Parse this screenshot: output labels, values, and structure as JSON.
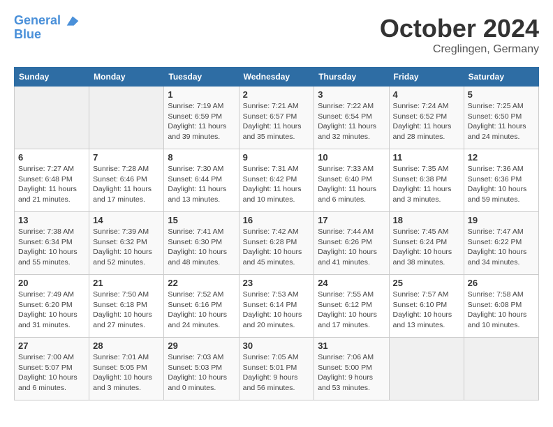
{
  "header": {
    "logo_line1": "General",
    "logo_line2": "Blue",
    "month": "October 2024",
    "location": "Creglingen, Germany"
  },
  "weekdays": [
    "Sunday",
    "Monday",
    "Tuesday",
    "Wednesday",
    "Thursday",
    "Friday",
    "Saturday"
  ],
  "weeks": [
    [
      {
        "num": "",
        "info": ""
      },
      {
        "num": "",
        "info": ""
      },
      {
        "num": "1",
        "info": "Sunrise: 7:19 AM\nSunset: 6:59 PM\nDaylight: 11 hours and 39 minutes."
      },
      {
        "num": "2",
        "info": "Sunrise: 7:21 AM\nSunset: 6:57 PM\nDaylight: 11 hours and 35 minutes."
      },
      {
        "num": "3",
        "info": "Sunrise: 7:22 AM\nSunset: 6:54 PM\nDaylight: 11 hours and 32 minutes."
      },
      {
        "num": "4",
        "info": "Sunrise: 7:24 AM\nSunset: 6:52 PM\nDaylight: 11 hours and 28 minutes."
      },
      {
        "num": "5",
        "info": "Sunrise: 7:25 AM\nSunset: 6:50 PM\nDaylight: 11 hours and 24 minutes."
      }
    ],
    [
      {
        "num": "6",
        "info": "Sunrise: 7:27 AM\nSunset: 6:48 PM\nDaylight: 11 hours and 21 minutes."
      },
      {
        "num": "7",
        "info": "Sunrise: 7:28 AM\nSunset: 6:46 PM\nDaylight: 11 hours and 17 minutes."
      },
      {
        "num": "8",
        "info": "Sunrise: 7:30 AM\nSunset: 6:44 PM\nDaylight: 11 hours and 13 minutes."
      },
      {
        "num": "9",
        "info": "Sunrise: 7:31 AM\nSunset: 6:42 PM\nDaylight: 11 hours and 10 minutes."
      },
      {
        "num": "10",
        "info": "Sunrise: 7:33 AM\nSunset: 6:40 PM\nDaylight: 11 hours and 6 minutes."
      },
      {
        "num": "11",
        "info": "Sunrise: 7:35 AM\nSunset: 6:38 PM\nDaylight: 11 hours and 3 minutes."
      },
      {
        "num": "12",
        "info": "Sunrise: 7:36 AM\nSunset: 6:36 PM\nDaylight: 10 hours and 59 minutes."
      }
    ],
    [
      {
        "num": "13",
        "info": "Sunrise: 7:38 AM\nSunset: 6:34 PM\nDaylight: 10 hours and 55 minutes."
      },
      {
        "num": "14",
        "info": "Sunrise: 7:39 AM\nSunset: 6:32 PM\nDaylight: 10 hours and 52 minutes."
      },
      {
        "num": "15",
        "info": "Sunrise: 7:41 AM\nSunset: 6:30 PM\nDaylight: 10 hours and 48 minutes."
      },
      {
        "num": "16",
        "info": "Sunrise: 7:42 AM\nSunset: 6:28 PM\nDaylight: 10 hours and 45 minutes."
      },
      {
        "num": "17",
        "info": "Sunrise: 7:44 AM\nSunset: 6:26 PM\nDaylight: 10 hours and 41 minutes."
      },
      {
        "num": "18",
        "info": "Sunrise: 7:45 AM\nSunset: 6:24 PM\nDaylight: 10 hours and 38 minutes."
      },
      {
        "num": "19",
        "info": "Sunrise: 7:47 AM\nSunset: 6:22 PM\nDaylight: 10 hours and 34 minutes."
      }
    ],
    [
      {
        "num": "20",
        "info": "Sunrise: 7:49 AM\nSunset: 6:20 PM\nDaylight: 10 hours and 31 minutes."
      },
      {
        "num": "21",
        "info": "Sunrise: 7:50 AM\nSunset: 6:18 PM\nDaylight: 10 hours and 27 minutes."
      },
      {
        "num": "22",
        "info": "Sunrise: 7:52 AM\nSunset: 6:16 PM\nDaylight: 10 hours and 24 minutes."
      },
      {
        "num": "23",
        "info": "Sunrise: 7:53 AM\nSunset: 6:14 PM\nDaylight: 10 hours and 20 minutes."
      },
      {
        "num": "24",
        "info": "Sunrise: 7:55 AM\nSunset: 6:12 PM\nDaylight: 10 hours and 17 minutes."
      },
      {
        "num": "25",
        "info": "Sunrise: 7:57 AM\nSunset: 6:10 PM\nDaylight: 10 hours and 13 minutes."
      },
      {
        "num": "26",
        "info": "Sunrise: 7:58 AM\nSunset: 6:08 PM\nDaylight: 10 hours and 10 minutes."
      }
    ],
    [
      {
        "num": "27",
        "info": "Sunrise: 7:00 AM\nSunset: 5:07 PM\nDaylight: 10 hours and 6 minutes."
      },
      {
        "num": "28",
        "info": "Sunrise: 7:01 AM\nSunset: 5:05 PM\nDaylight: 10 hours and 3 minutes."
      },
      {
        "num": "29",
        "info": "Sunrise: 7:03 AM\nSunset: 5:03 PM\nDaylight: 10 hours and 0 minutes."
      },
      {
        "num": "30",
        "info": "Sunrise: 7:05 AM\nSunset: 5:01 PM\nDaylight: 9 hours and 56 minutes."
      },
      {
        "num": "31",
        "info": "Sunrise: 7:06 AM\nSunset: 5:00 PM\nDaylight: 9 hours and 53 minutes."
      },
      {
        "num": "",
        "info": ""
      },
      {
        "num": "",
        "info": ""
      }
    ]
  ]
}
